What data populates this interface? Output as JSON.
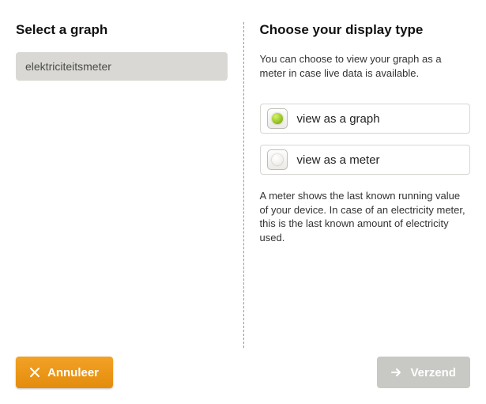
{
  "left": {
    "title": "Select a graph",
    "selected_graph": "elektriciteitsmeter"
  },
  "right": {
    "title": "Choose your display type",
    "description": "You can choose to view your graph as a meter in case live data is available.",
    "options": {
      "graph": "view as a graph",
      "meter": "view as a meter"
    },
    "selected": "graph",
    "note": "A meter shows the last known running value of your device.  In case of an electricity meter, this is the last known amount of electricity used."
  },
  "footer": {
    "cancel_label": "Annuleer",
    "submit_label": "Verzend"
  }
}
